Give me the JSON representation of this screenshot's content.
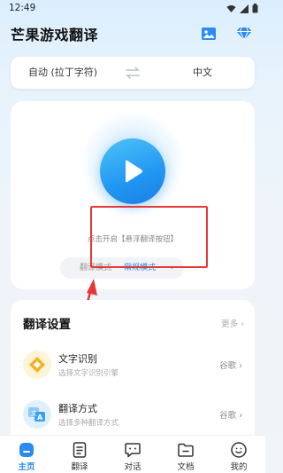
{
  "status_bar": {
    "time": "12:49"
  },
  "header": {
    "title": "芒果游戏翻译",
    "image_icon": "image-icon",
    "vip_icon": "diamond-icon"
  },
  "language": {
    "source": "自动 (拉丁字符)",
    "target": "中文",
    "swap_icon": "swap-arrows-icon"
  },
  "main": {
    "hint": "点击开启【悬浮翻译按钮】",
    "mode_a": "翻译模式",
    "mode_b": "常规模式",
    "mode_arrow": "›"
  },
  "settings": {
    "title": "翻译设置",
    "more": "更多 ›",
    "items": [
      {
        "name": "文字识别",
        "desc": "选择文字识别引擎",
        "value": "谷歌 ›",
        "icon": "diamond-scan-icon"
      },
      {
        "name": "翻译方式",
        "desc": "选择多种翻译方式",
        "value": "谷歌 ›",
        "icon": "translate-icon"
      }
    ]
  },
  "nav": {
    "items": [
      {
        "label": "主页",
        "icon": "home-icon"
      },
      {
        "label": "翻译",
        "icon": "document-icon"
      },
      {
        "label": "对话",
        "icon": "chat-icon"
      },
      {
        "label": "文档",
        "icon": "folder-icon"
      },
      {
        "label": "我的",
        "icon": "profile-icon"
      }
    ]
  },
  "colors": {
    "accent": "#2a8cf0",
    "annotation": "#e53935"
  }
}
